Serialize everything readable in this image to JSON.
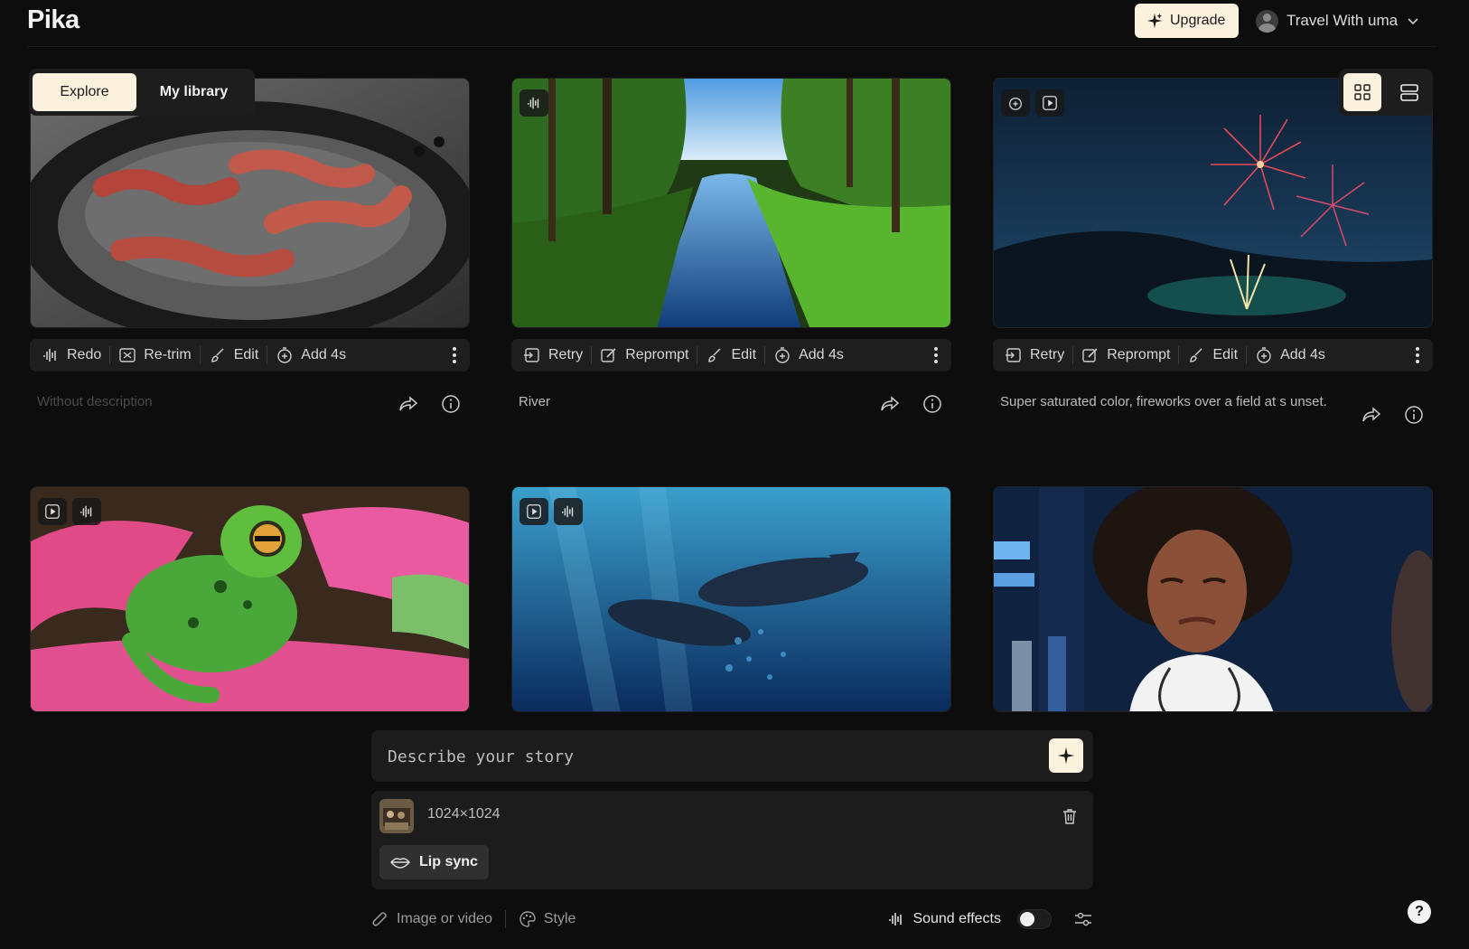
{
  "app": {
    "logo": "Pika"
  },
  "header": {
    "upgrade_label": "Upgrade",
    "account_name": "Travel With uma"
  },
  "tabs": [
    {
      "label": "Explore",
      "active": true
    },
    {
      "label": "My library",
      "active": false
    }
  ],
  "cards": [
    {
      "description": "Without description",
      "actions": [
        "Redo",
        "Re-trim",
        "Edit",
        "Add 4s"
      ]
    },
    {
      "description": "River",
      "actions": [
        "Retry",
        "Reprompt",
        "Edit",
        "Add 4s"
      ]
    },
    {
      "description": "Super saturated color, fireworks over a field at s unset.",
      "actions": [
        "Retry",
        "Reprompt",
        "Edit",
        "Add 4s"
      ]
    }
  ],
  "composer": {
    "placeholder": "Describe your story",
    "attachment_size": "1024×1024",
    "lip_sync_label": "Lip sync",
    "image_or_video_label": "Image or video",
    "style_label": "Style",
    "sound_effects_label": "Sound effects",
    "sound_effects_on": false
  },
  "help_label": "?",
  "colors": {
    "accent_cream": "#fbf1dc",
    "background": "#0d0d0d",
    "surface": "#1e1e1e"
  }
}
